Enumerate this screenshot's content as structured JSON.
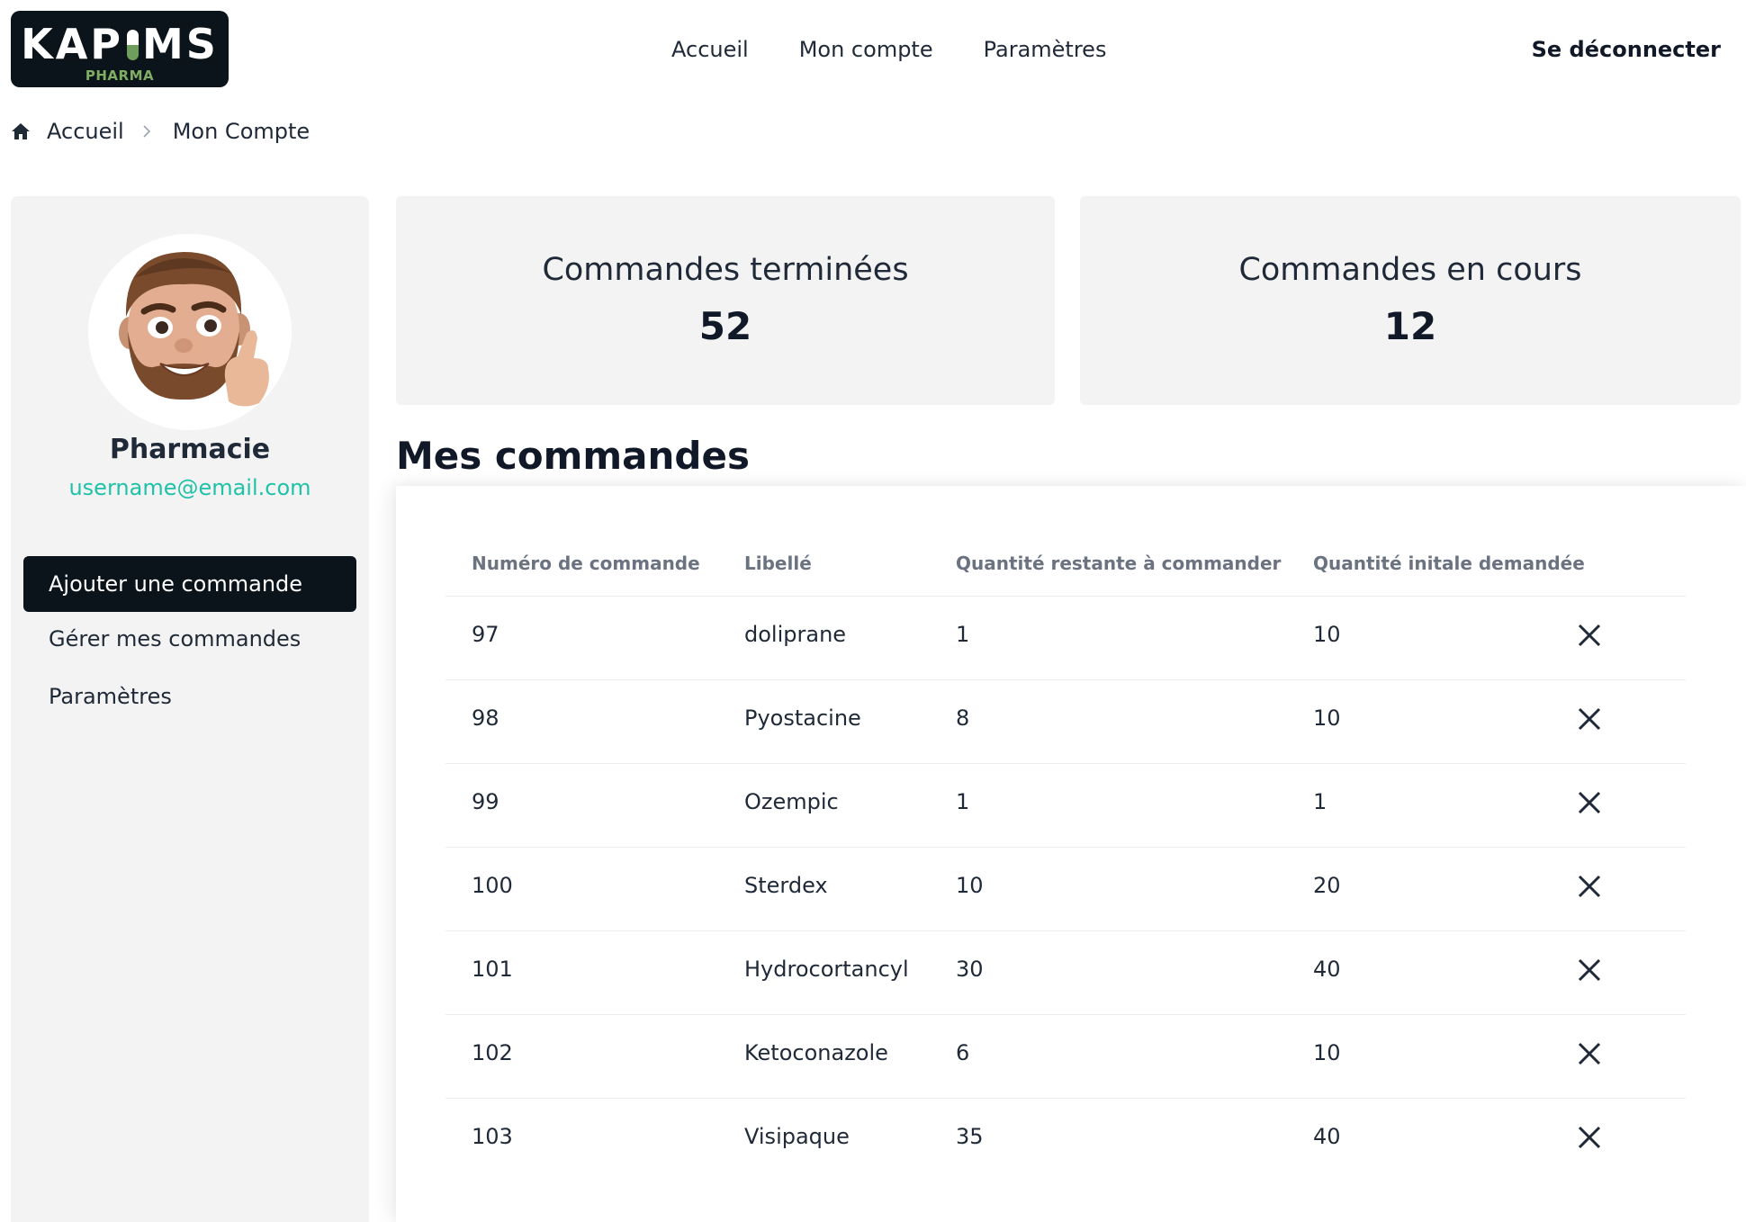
{
  "header": {
    "logo_text_1": "KAP",
    "logo_text_2": "MS",
    "logo_subtitle": "PHARMA",
    "nav": [
      "Accueil",
      "Mon compte",
      "Paramètres"
    ],
    "logout": "Se déconnecter"
  },
  "breadcrumb": {
    "home": "Accueil",
    "current": "Mon Compte"
  },
  "profile": {
    "name": "Pharmacie",
    "email": "username@email.com"
  },
  "sidebar": {
    "primary": "Ajouter une commande",
    "items": [
      "Gérer mes commandes",
      "Paramètres"
    ]
  },
  "stats": [
    {
      "label": "Commandes terminées",
      "value": "52"
    },
    {
      "label": "Commandes en cours",
      "value": "12"
    }
  ],
  "orders": {
    "title": "Mes commandes",
    "columns": [
      "Numéro de commande",
      "Libellé",
      "Quantité restante à commander",
      "Quantité initale demandée"
    ],
    "rows": [
      {
        "id": "97",
        "label": "doliprane",
        "remaining": "1",
        "initial": "10"
      },
      {
        "id": "98",
        "label": "Pyostacine",
        "remaining": "8",
        "initial": "10"
      },
      {
        "id": "99",
        "label": "Ozempic",
        "remaining": "1",
        "initial": "1"
      },
      {
        "id": "100",
        "label": "Sterdex",
        "remaining": "10",
        "initial": "20"
      },
      {
        "id": "101",
        "label": "Hydrocortancyl",
        "remaining": "30",
        "initial": "40"
      },
      {
        "id": "102",
        "label": "Ketoconazole",
        "remaining": "6",
        "initial": "10"
      },
      {
        "id": "103",
        "label": "Visipaque",
        "remaining": "35",
        "initial": "40"
      }
    ]
  },
  "colors": {
    "accent": "#1fc2a8",
    "dark": "#0b141a",
    "panel": "#f3f3f3",
    "logo_green": "#7fae63"
  },
  "icons": {
    "home": "home-icon",
    "chevron": "chevron-right-icon",
    "delete": "close-icon"
  }
}
